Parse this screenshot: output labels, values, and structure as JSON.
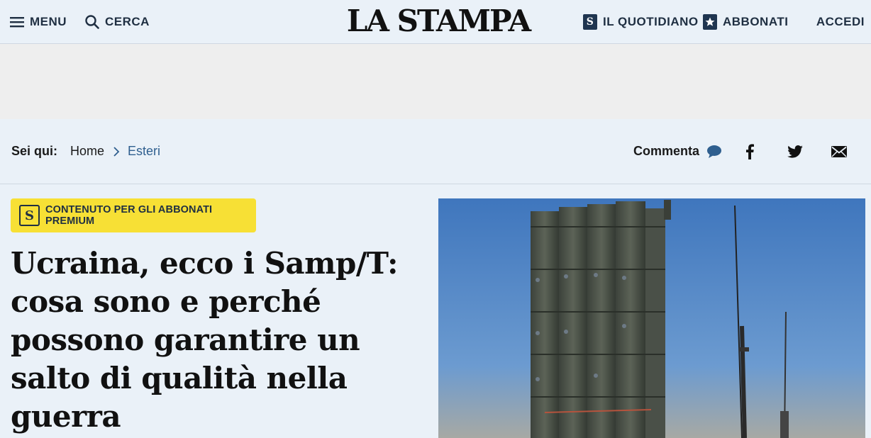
{
  "header": {
    "menu_label": "MENU",
    "search_label": "CERCA",
    "logo_text": "LA STAMPA",
    "quotidiano_label": "IL QUOTIDIANO",
    "abbonati_label": "ABBONATI",
    "accedi_label": "ACCEDI",
    "badge_letter": "S"
  },
  "breadcrumb": {
    "prefix": "Sei qui:",
    "items": [
      "Home",
      "Esteri"
    ]
  },
  "social": {
    "comment_label": "Commenta"
  },
  "article": {
    "premium_letter": "S",
    "premium_label": "CONTENUTO PER GLI ABBONATI PREMIUM",
    "title": "Ucraina, ecco i Samp/T: cosa sono e perché possono garantire un salto di qualità nella guerra"
  },
  "colors": {
    "background": "#eaf1f8",
    "navy": "#1f3550",
    "premium_yellow": "#f7e035",
    "link_blue": "#2f5f8f"
  }
}
